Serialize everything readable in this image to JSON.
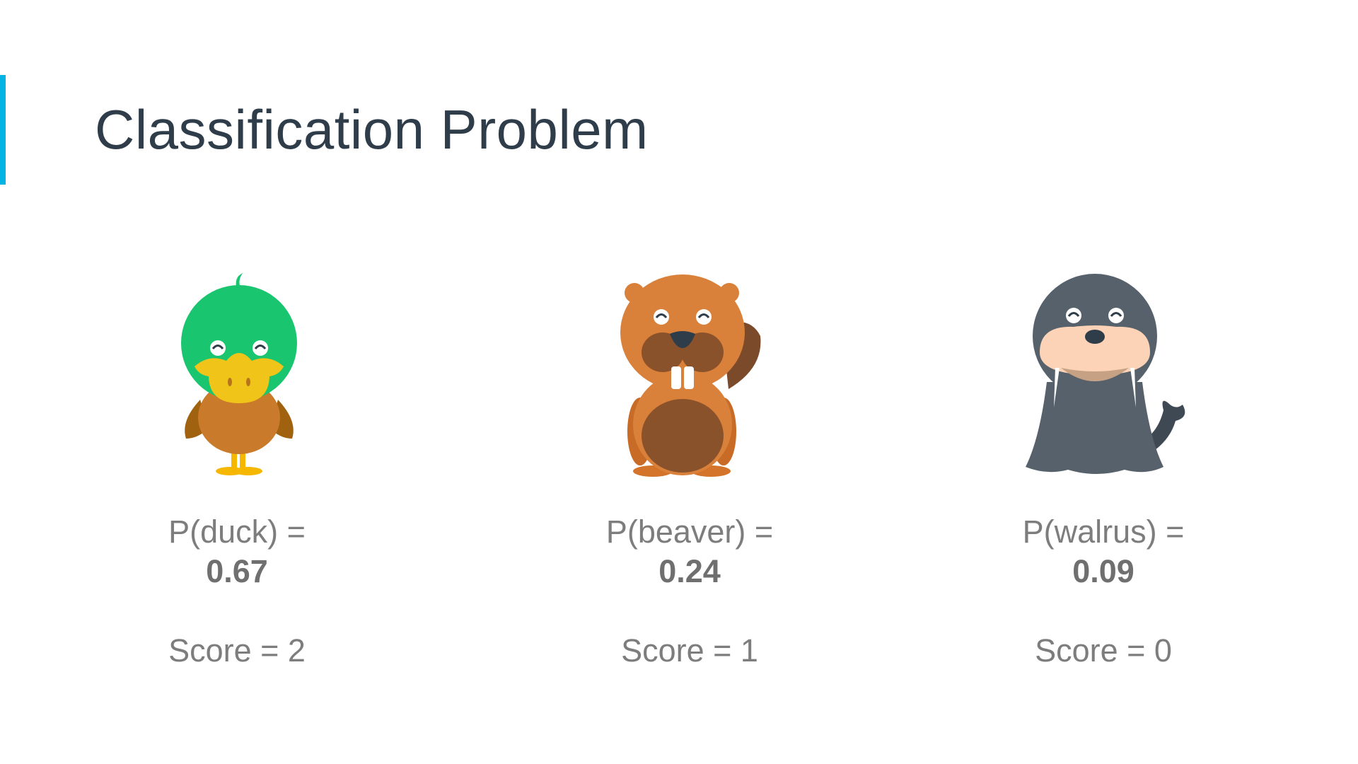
{
  "slide": {
    "title": "Classification Problem",
    "accent_color": "#02b3e4"
  },
  "animals": [
    {
      "name": "duck",
      "icon": "duck-icon",
      "probability_label": "P(duck) =",
      "probability_value": "0.67",
      "score_label": "Score = 2"
    },
    {
      "name": "beaver",
      "icon": "beaver-icon",
      "probability_label": "P(beaver) =",
      "probability_value": "0.24",
      "score_label": "Score = 1"
    },
    {
      "name": "walrus",
      "icon": "walrus-icon",
      "probability_label": "P(walrus) =",
      "probability_value": "0.09",
      "score_label": "Score = 0"
    }
  ]
}
